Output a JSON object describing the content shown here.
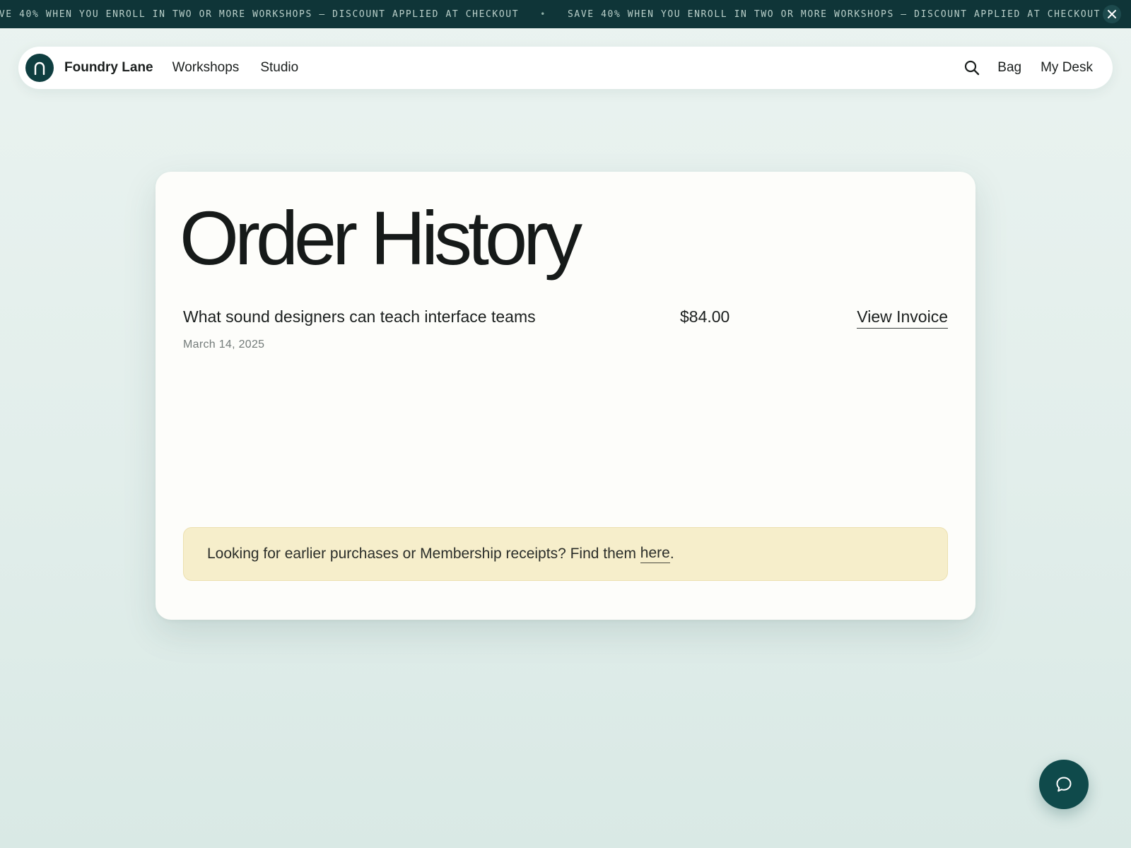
{
  "promo": {
    "message": "SAVE 40% WHEN YOU ENROLL IN TWO OR MORE WORKSHOPS — DISCOUNT APPLIED AT CHECKOUT",
    "separator": "•",
    "close_icon": "close-icon"
  },
  "nav": {
    "brand": "Foundry Lane",
    "links": [
      "Workshops",
      "Studio"
    ],
    "search_icon": "search-icon",
    "right_links": [
      "Bag",
      "My Desk"
    ]
  },
  "page": {
    "title": "Order History"
  },
  "orders": [
    {
      "title": "What sound designers can teach interface teams",
      "date": "March 14, 2025",
      "price": "$84.00",
      "action": "View Invoice"
    }
  ],
  "notice": {
    "text": "Looking for earlier purchases or Membership receipts? Find them ",
    "link": "here",
    "suffix": "."
  },
  "chat": {
    "icon": "chat-bubble-icon"
  },
  "colors": {
    "banner": "#0f3538",
    "brand_teal": "#0f4a4b",
    "notice_bg": "#f6eecb",
    "page_bg": "#e2eeeb"
  }
}
